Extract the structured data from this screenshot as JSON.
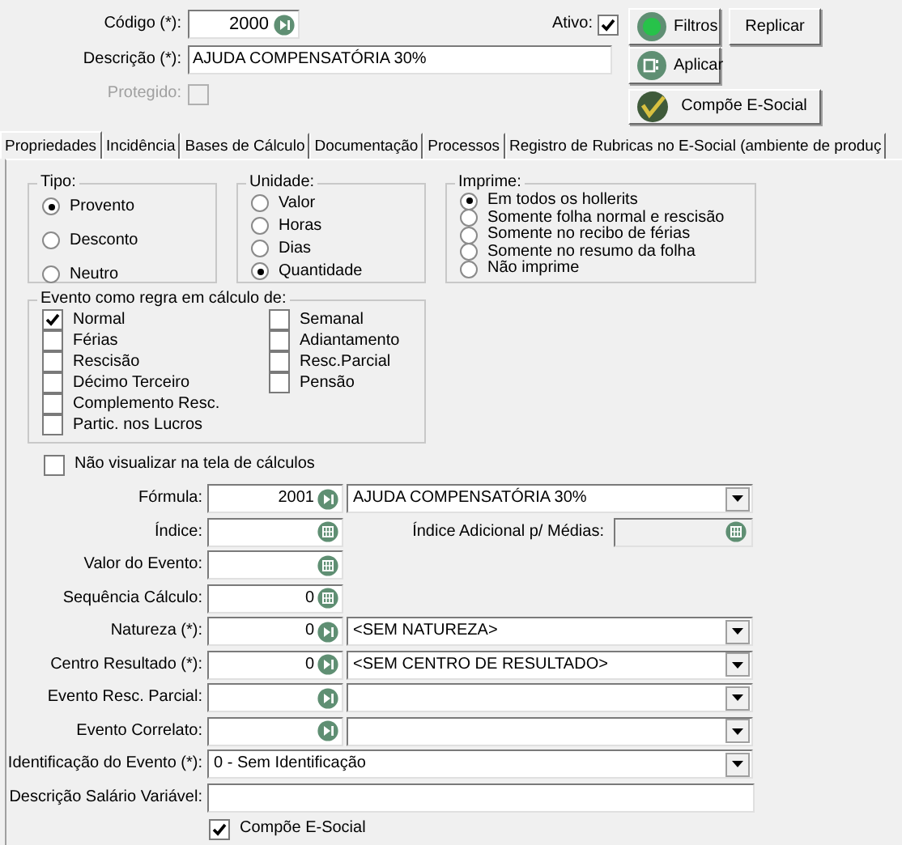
{
  "header": {
    "codigo": {
      "label": "Código (*):",
      "value": "2000"
    },
    "descricao": {
      "label": "Descrição (*):",
      "value": "AJUDA COMPENSATÓRIA 30%"
    },
    "protegido": {
      "label": "Protegido:",
      "checked": false,
      "disabled": true
    },
    "ativo": {
      "label": "Ativo:",
      "checked": true
    },
    "buttons": [
      {
        "label": "Filtros",
        "kind": "filter"
      },
      {
        "label": "Replicar",
        "kind": "plain"
      },
      {
        "label": "Aplicar",
        "kind": "apply"
      },
      {
        "label": "Compõe E-Social",
        "kind": "esocial"
      }
    ]
  },
  "tabs": [
    {
      "label": "Propriedades",
      "selected": true
    },
    {
      "label": "Incidência",
      "selected": false
    },
    {
      "label": "Bases de Cálculo",
      "selected": false
    },
    {
      "label": "Documentação",
      "selected": false
    },
    {
      "label": "Processos",
      "selected": false
    },
    {
      "label": "Registro de Rubricas no E-Social (ambiente de produç",
      "selected": false
    }
  ],
  "tipo": {
    "title": "Tipo:",
    "options": [
      {
        "label": "Provento",
        "selected": true
      },
      {
        "label": "Desconto",
        "selected": false
      },
      {
        "label": "Neutro",
        "selected": false
      }
    ]
  },
  "unidade": {
    "title": "Unidade:",
    "options": [
      {
        "label": "Valor",
        "selected": false
      },
      {
        "label": "Horas",
        "selected": false
      },
      {
        "label": "Dias",
        "selected": false
      },
      {
        "label": "Quantidade",
        "selected": true
      }
    ]
  },
  "imprime": {
    "title": "Imprime:",
    "options": [
      {
        "label": "Em todos os hollerits",
        "selected": true
      },
      {
        "label": "Somente folha normal e rescisão",
        "selected": false
      },
      {
        "label": "Somente no recibo de férias",
        "selected": false
      },
      {
        "label": "Somente no resumo da folha",
        "selected": false
      },
      {
        "label": "Não imprime",
        "selected": false
      }
    ]
  },
  "evento": {
    "title": "Evento como regra em cálculo de:",
    "columns": [
      [
        {
          "label": "Normal",
          "checked": true
        },
        {
          "label": "Férias",
          "checked": false
        },
        {
          "label": "Rescisão",
          "checked": false
        },
        {
          "label": "Décimo Terceiro",
          "checked": false
        },
        {
          "label": "Complemento Resc.",
          "checked": false
        },
        {
          "label": "Partic. nos Lucros",
          "checked": false
        }
      ],
      [
        {
          "label": "Semanal",
          "checked": false
        },
        {
          "label": "Adiantamento",
          "checked": false
        },
        {
          "label": "Resc.Parcial",
          "checked": false
        },
        {
          "label": "Pensão",
          "checked": false
        }
      ]
    ]
  },
  "nao_visualizar": {
    "label": "Não visualizar na tela de cálculos",
    "checked": false
  },
  "fields": [
    {
      "label": "Fórmula:",
      "kind": "lookup_combo",
      "value": "2001",
      "combo": "AJUDA COMPENSATÓRIA 30%"
    },
    {
      "label": "Índice:",
      "kind": "calc",
      "extra": {
        "label": "Índice Adicional p/ Médias:",
        "disabled": true
      }
    },
    {
      "label": "Valor do Evento:",
      "kind": "calc"
    },
    {
      "label": "Sequência Cálculo:",
      "kind": "calc",
      "value": "0"
    },
    {
      "label": "Natureza (*):",
      "kind": "lookup_combo",
      "value": "0",
      "combo": "<SEM NATUREZA>"
    },
    {
      "label": "Centro Resultado (*):",
      "kind": "lookup_combo",
      "value": "0",
      "combo": "<SEM CENTRO DE RESULTADO>"
    },
    {
      "label": "Evento Resc. Parcial:",
      "kind": "lookup_combo"
    },
    {
      "label": "Evento Correlato:",
      "kind": "lookup_combo"
    },
    {
      "label": "Identificação do Evento (*):",
      "kind": "combo",
      "combo": "0 - Sem Identificação"
    },
    {
      "label": "Descrição Salário Variável:",
      "kind": "text"
    }
  ],
  "compoe": {
    "label": "Compõe E-Social",
    "checked": true
  }
}
